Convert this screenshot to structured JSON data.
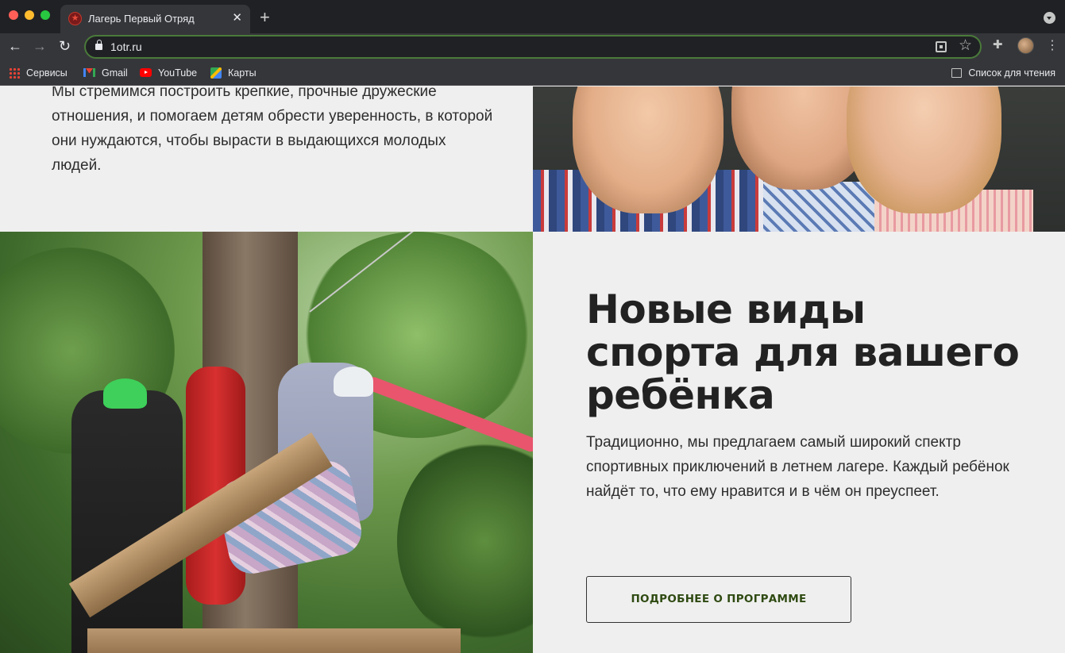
{
  "browser": {
    "tab": {
      "title": "Лагерь Первый Отряд",
      "close": "✕"
    },
    "new_tab": "+",
    "address": {
      "url": "1otr.ru"
    },
    "bookmarks": [
      {
        "label": "Сервисы",
        "icon": "apps-grid-icon"
      },
      {
        "label": "Gmail",
        "icon": "gmail-icon"
      },
      {
        "label": "YouTube",
        "icon": "youtube-icon"
      },
      {
        "label": "Карты",
        "icon": "maps-icon"
      }
    ],
    "reading_list": {
      "label": "Список для чтения",
      "icon": "reading-list-icon"
    }
  },
  "page": {
    "intro_text": "Мы стремимся построить крепкие, прочные дружеские отношения, и помогаем детям обрести уверенность, в которой они нуждаются, чтобы вырасти в выдающихся молодых людей.",
    "sports_heading": "Новые виды спорта для вашего ребёнка",
    "sports_text": "Традиционно, мы предлагаем самый широкий спектр спортивных приключений в летнем лагере. Каждый ребёнок найдёт то, что ему нравится и в чём он преуспеет.",
    "cta_label": "ПОДРОБНЕЕ О ПРОГРАММЕ"
  },
  "colors": {
    "page_bg": "#efefef",
    "heading": "#222222",
    "cta_text": "#2f4a12",
    "omnibox_focus": "#4a7a3a"
  }
}
